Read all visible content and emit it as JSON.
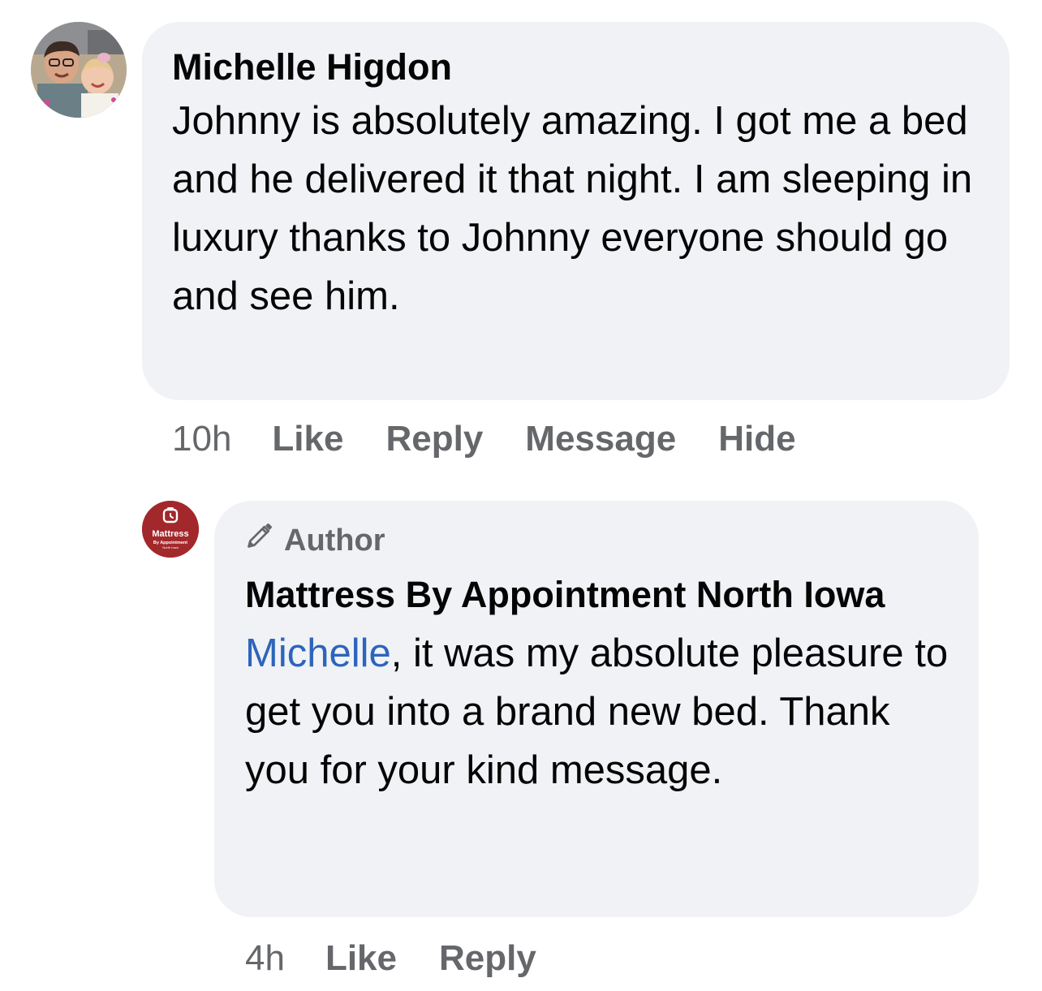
{
  "comment": {
    "author": "Michelle Higdon",
    "text": "Johnny is absolutely amazing. I got me a bed and he delivered it that night. I am sleeping in luxury thanks to Johnny everyone should go and see him.",
    "time": "10h",
    "actions": {
      "like": "Like",
      "reply": "Reply",
      "message": "Message",
      "hide": "Hide"
    }
  },
  "reply": {
    "badge": "Author",
    "author": "Mattress By Appointment North Iowa",
    "mention": "Michelle",
    "text": ", it was my absolute pleasure to get you into a brand new bed. Thank you for your kind message.",
    "time": "4h",
    "actions": {
      "like": "Like",
      "reply": "Reply"
    },
    "avatar_logo": {
      "title": "Mattress",
      "subtitle": "By Appointment",
      "tagline": "North Iowa"
    }
  },
  "colors": {
    "bubble": "#f0f2f5",
    "meta_text": "#65676b",
    "mention": "#2d64bc",
    "brand_red": "#a3282b"
  },
  "icons": {
    "author_badge": "pencil-icon"
  }
}
